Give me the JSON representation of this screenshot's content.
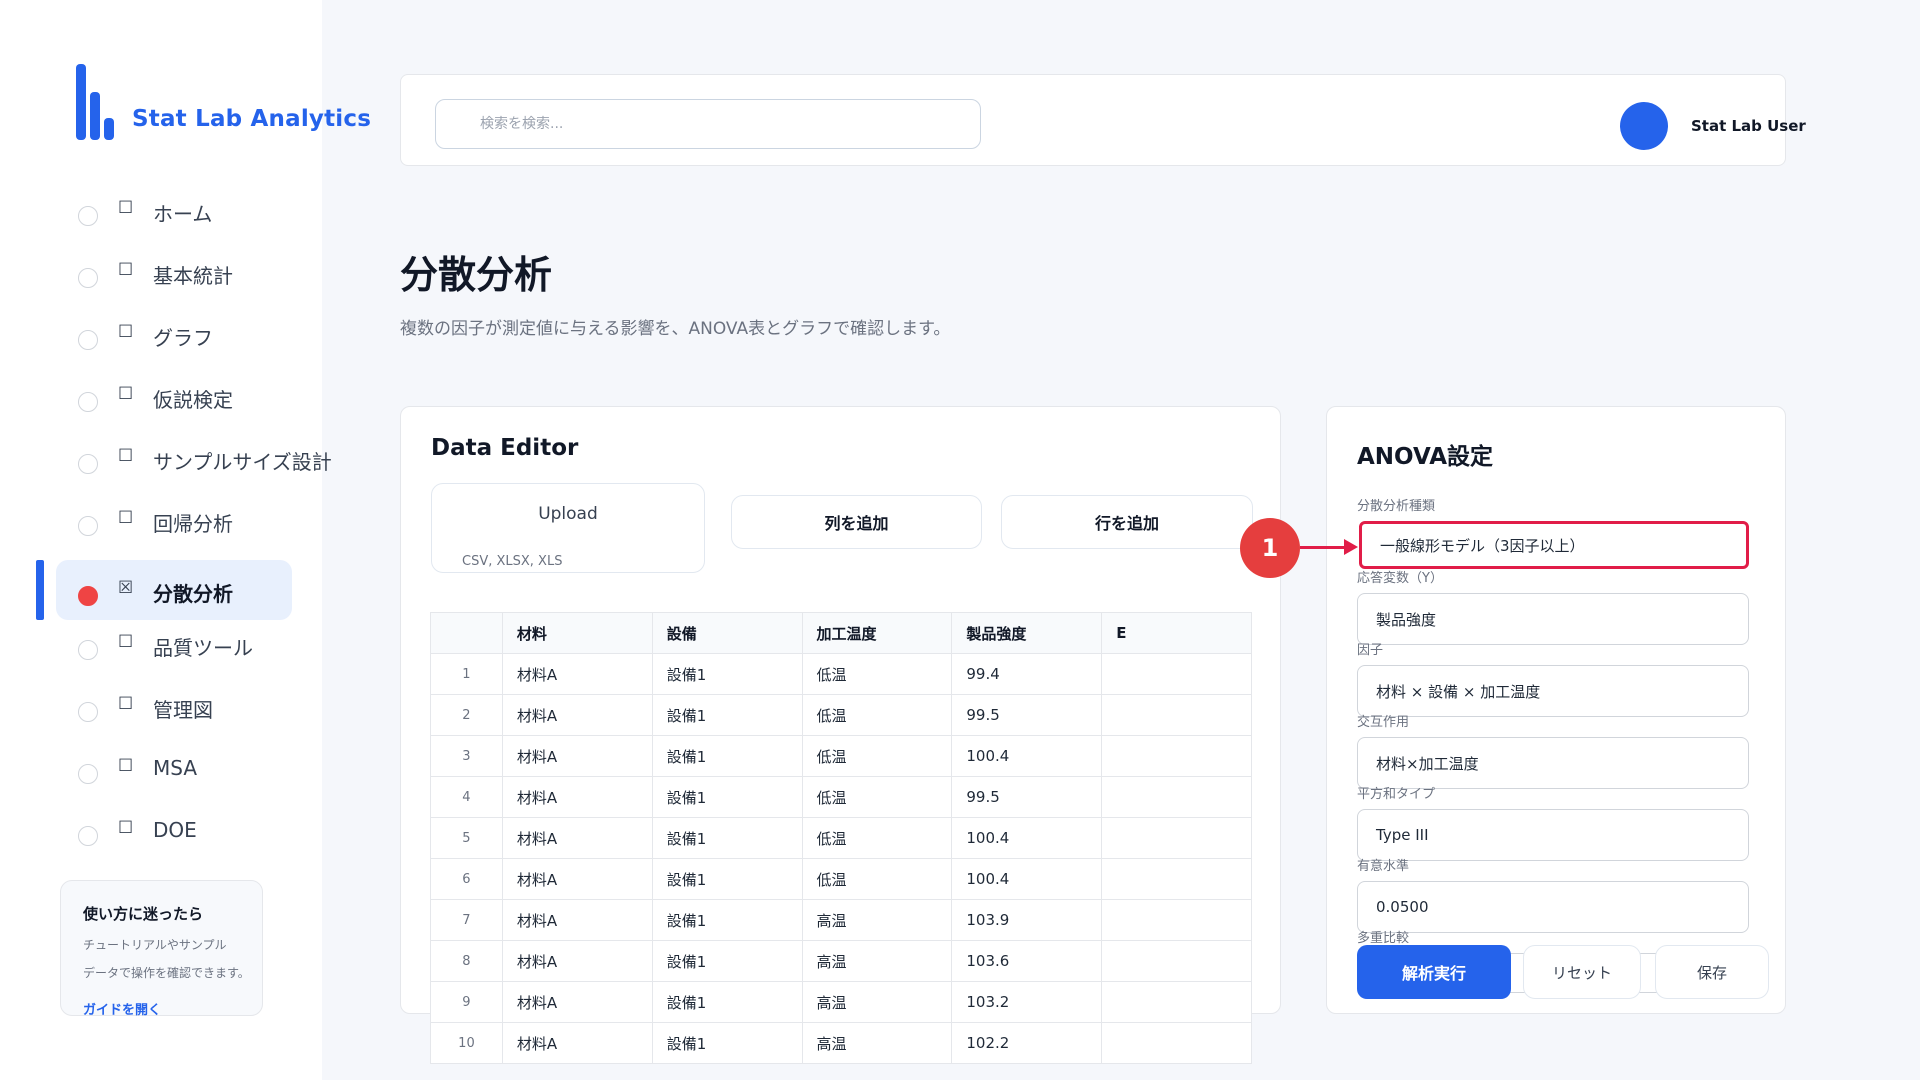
{
  "app": {
    "name": "Stat Lab Analytics"
  },
  "header": {
    "search_placeholder": "検索を検索...",
    "user_name": "Stat Lab User"
  },
  "sidebar": {
    "items": [
      {
        "label": "ホーム",
        "box": "☐"
      },
      {
        "label": "基本統計",
        "box": "☐"
      },
      {
        "label": "グラフ",
        "box": "☐"
      },
      {
        "label": "仮説検定",
        "box": "☐"
      },
      {
        "label": "サンプルサイズ設計",
        "box": "☐"
      },
      {
        "label": "回帰分析",
        "box": "☐"
      },
      {
        "label": "分散分析",
        "box": "☒"
      },
      {
        "label": "品質ツール",
        "box": "☐"
      },
      {
        "label": "管理図",
        "box": "☐"
      },
      {
        "label": "MSA",
        "box": "☐"
      },
      {
        "label": "DOE",
        "box": "☐"
      }
    ],
    "active_index": 6,
    "help": {
      "title": "使い方に迷ったら",
      "text_line1": "チュートリアルやサンプル",
      "text_line2": "データで操作を確認できます。",
      "link": "ガイドを開く"
    }
  },
  "page": {
    "title": "分散分析",
    "subtitle": "複数の因子が測定値に与える影響を、ANOVA表とグラフで確認します。"
  },
  "editor": {
    "title": "Data Editor",
    "upload_label": "Upload",
    "upload_formats": "CSV, XLSX, XLS",
    "add_column": "列を追加",
    "add_row": "行を追加",
    "columns": [
      "",
      "材料",
      "設備",
      "加工温度",
      "製品強度",
      "E"
    ],
    "rows": [
      [
        "1",
        "材料A",
        "設備1",
        "低温",
        "99.4",
        ""
      ],
      [
        "2",
        "材料A",
        "設備1",
        "低温",
        "99.5",
        ""
      ],
      [
        "3",
        "材料A",
        "設備1",
        "低温",
        "100.4",
        ""
      ],
      [
        "4",
        "材料A",
        "設備1",
        "低温",
        "99.5",
        ""
      ],
      [
        "5",
        "材料A",
        "設備1",
        "低温",
        "100.4",
        ""
      ],
      [
        "6",
        "材料A",
        "設備1",
        "低温",
        "100.4",
        ""
      ],
      [
        "7",
        "材料A",
        "設備1",
        "高温",
        "103.9",
        ""
      ],
      [
        "8",
        "材料A",
        "設備1",
        "高温",
        "103.6",
        ""
      ],
      [
        "9",
        "材料A",
        "設備1",
        "高温",
        "103.2",
        ""
      ],
      [
        "10",
        "材料A",
        "設備1",
        "高温",
        "102.2",
        ""
      ]
    ]
  },
  "anova": {
    "title": "ANOVA設定",
    "fields": [
      {
        "label": "分散分析種類",
        "value": "一般線形モデル（3因子以上）"
      },
      {
        "label": "応答変数（Y）",
        "value": "製品強度"
      },
      {
        "label": "因子",
        "value": "材料 × 設備 × 加工温度"
      },
      {
        "label": "交互作用",
        "value": "材料×加工温度"
      },
      {
        "label": "平方和タイプ",
        "value": "Type III"
      },
      {
        "label": "有意水準",
        "value": "0.0500"
      },
      {
        "label": "多重比較",
        "value": ""
      }
    ],
    "run": "解析実行",
    "reset": "リセット",
    "save": "保存"
  },
  "annotation": {
    "marker": "1"
  },
  "colors": {
    "accent": "#2563eb",
    "highlight": "#e11d48",
    "marker": "#e53e3e"
  }
}
